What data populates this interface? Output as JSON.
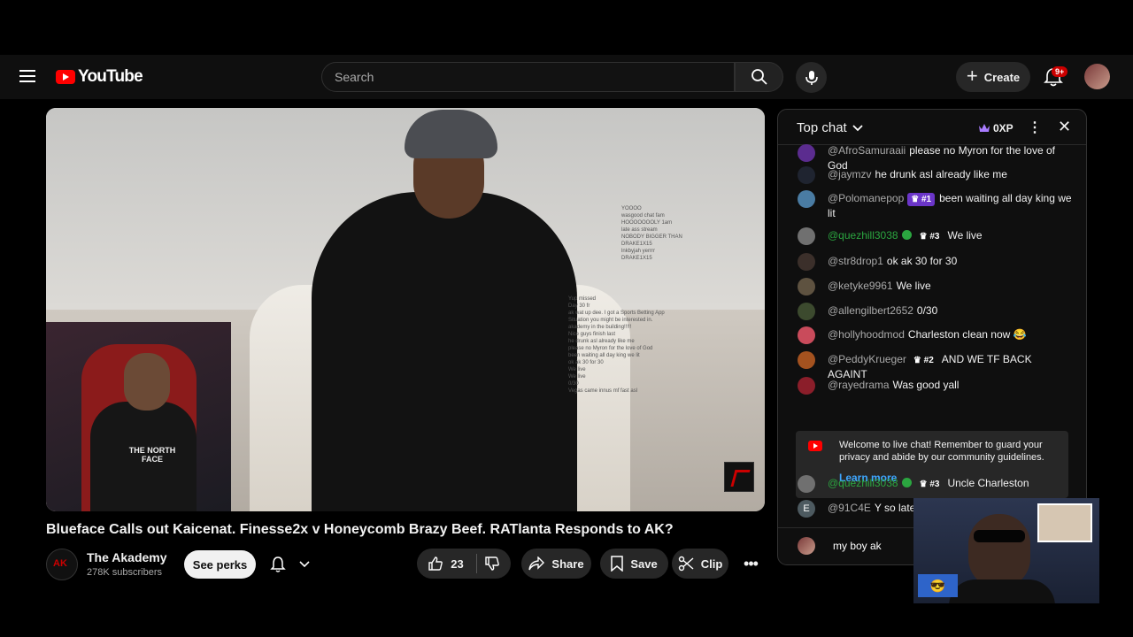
{
  "header": {
    "logo_text": "YouTube",
    "search_placeholder": "Search",
    "create_label": "Create",
    "notification_count": "9+"
  },
  "video": {
    "title": "Blueface Calls out Kaicenat. Finesse2x v Honeycomb Brazy Beef. RATlanta Responds to AK?",
    "overlay_chat_lines": [
      "YOOOO",
      "wasgood chat fam",
      "HOOOOOOOLY 1am",
      "late ass stream",
      "NOBODY BIGGER THAN",
      "DRAKE1X15",
      "lnkbyjah  yerrrr",
      "DRAKE1X15",
      "Yup missed",
      "Day 30 fr",
      "ak wat up dee. I got a Sports Betting App",
      "Situation you might be interested in.",
      "akademy in the building!!!!!",
      "Nice guys finish last",
      "he drunk asl already like me",
      "please no Myron for the love of God",
      "been waiting all day king we lit",
      "ok ak 30 for 30",
      "We live",
      "We live",
      "0/30",
      "Vegas came innus mf fast asl"
    ],
    "streamer_shirt_text": "THE NORTH FACE"
  },
  "channel": {
    "name": "The Akademy",
    "subscribers": "278K subscribers",
    "perks_label": "See perks"
  },
  "actions": {
    "like_count": "23",
    "share_label": "Share",
    "save_label": "Save",
    "clip_label": "Clip"
  },
  "chat": {
    "mode_label": "Top chat",
    "xp_label": "0XP",
    "messages": [
      {
        "author": "@AfroSamuraaii",
        "text": "please no Myron for the love of God"
      },
      {
        "author": "@jaymzv",
        "text": "he drunk asl already like me"
      },
      {
        "author": "@Polomanepop",
        "badge": "#1",
        "text": "been waiting all day king we lit"
      },
      {
        "author": "@quezhill3038",
        "badge": "#3",
        "text": "We live"
      },
      {
        "author": "@str8drop1",
        "text": "ok ak 30 for 30"
      },
      {
        "author": "@ketyke9961",
        "text": "We live"
      },
      {
        "author": "@allengilbert2652",
        "text": "0/30"
      },
      {
        "author": "@hollyhoodmod",
        "text": "Charleston clean now",
        "emoji": "😂"
      },
      {
        "author": "@PeddyKrueger",
        "badge": "#2",
        "text": "AND WE TF BACK AGAINT"
      },
      {
        "author": "@rayedrama",
        "text": "Was good yall"
      },
      {
        "author": "@quezhill3038",
        "badge": "#3",
        "text": "Uncle Charleston"
      },
      {
        "author": "@91C4E",
        "text": "Y so late"
      }
    ],
    "welcome_text": "Welcome to live chat! Remember to guard your privacy and abide by our community guidelines.",
    "learn_more": "Learn more",
    "input_value": "my boy ak",
    "avatar_letter_e": "E"
  },
  "webcam": {
    "emoji": "😎"
  },
  "colors": {
    "brand_red": "#ff0000",
    "badge_purple": "#6b35c8",
    "moderator_green": "#2ba640",
    "link_blue": "#3ea6ff"
  }
}
